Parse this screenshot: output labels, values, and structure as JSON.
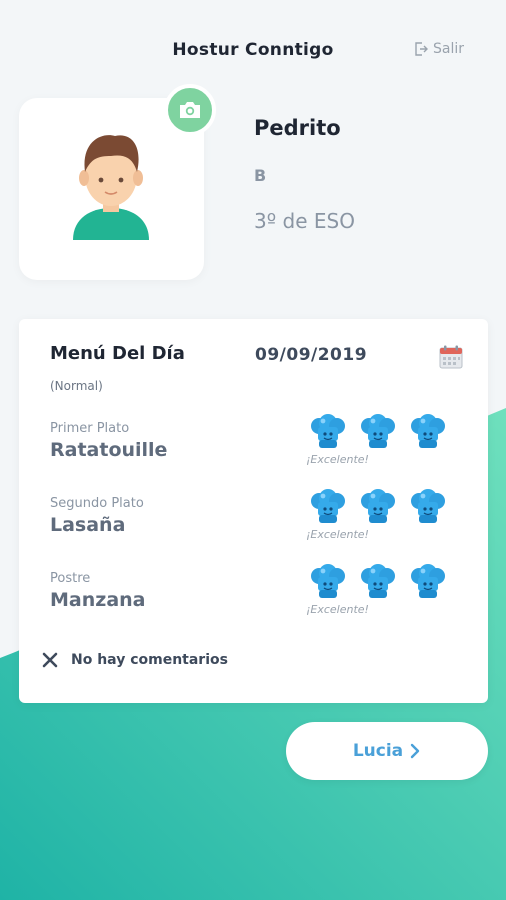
{
  "header": {
    "title": "Hostur Conntigo",
    "logout_label": "Salir"
  },
  "profile": {
    "name": "Pedrito",
    "group": "B",
    "class": "3º de ESO"
  },
  "menu": {
    "title": "Menú Del Día",
    "date": "09/09/2019",
    "type": "(Normal)",
    "dishes": [
      {
        "label": "Primer Plato",
        "name": "Ratatouille",
        "rating": "¡Excelente!",
        "stars": 3
      },
      {
        "label": "Segundo Plato",
        "name": "Lasaña",
        "rating": "¡Excelente!",
        "stars": 3
      },
      {
        "label": "Postre",
        "name": "Manzana",
        "rating": "¡Excelente!",
        "stars": 3
      }
    ],
    "comments": "No hay comentarios"
  },
  "next_button": {
    "label": "Lucia"
  },
  "colors": {
    "accent_green": "#7fd3a0",
    "accent_blue": "#4aa0d8",
    "teal_gradient_start": "#1fb3a6",
    "teal_gradient_end": "#6fe0bd"
  },
  "icons": {
    "logout": "logout-icon",
    "camera": "camera-icon",
    "calendar": "calendar-icon",
    "rating": "chef-hat-icon",
    "close": "close-icon",
    "chevron": "chevron-right-icon"
  }
}
